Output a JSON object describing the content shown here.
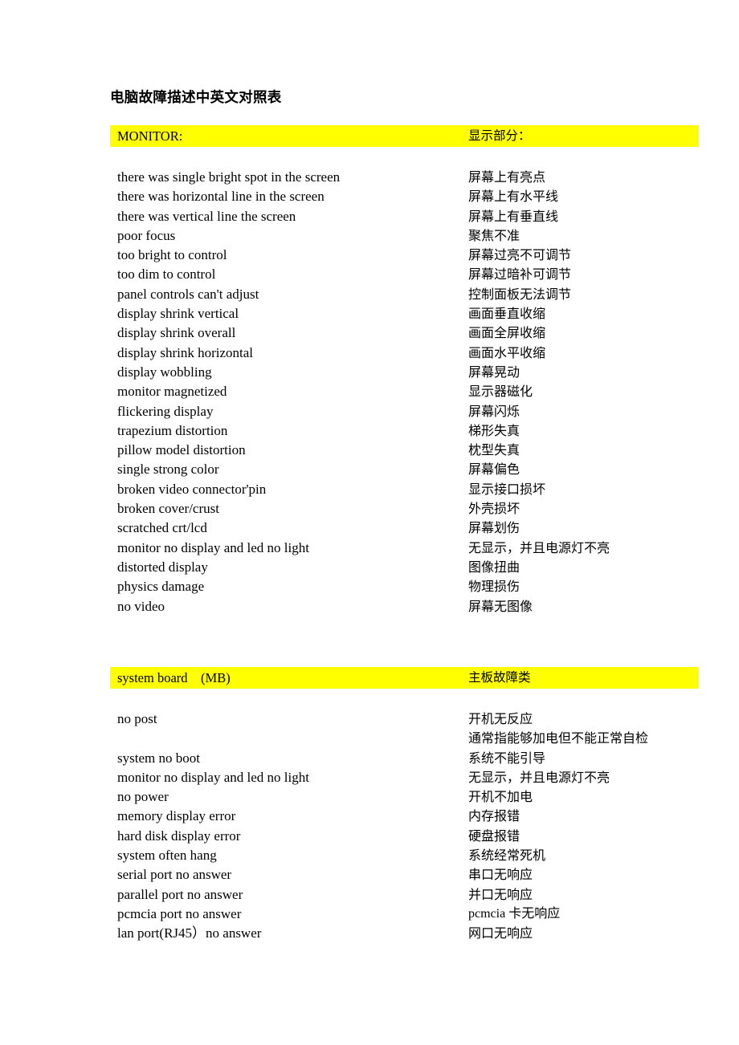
{
  "document": {
    "title": "电脑故障描述中英文对照表"
  },
  "colors": {
    "highlight": "#ffff00",
    "text": "#000000",
    "page_background": "#ffffff"
  },
  "sections": [
    {
      "id": "monitor",
      "header_en": "MONITOR:",
      "header_zh": "显示部分：",
      "rows": [
        {
          "en": "there was single bright spot in the screen",
          "zh": "屏幕上有亮点"
        },
        {
          "en": "there was horizontal line in the screen",
          "zh": "屏幕上有水平线"
        },
        {
          "en": "there was vertical line the screen",
          "zh": "屏幕上有垂直线"
        },
        {
          "en": "poor focus",
          "zh": "聚焦不准"
        },
        {
          "en": "too bright to control",
          "zh": "屏幕过亮不可调节"
        },
        {
          "en": "too dim to control",
          "zh": "屏幕过暗补可调节"
        },
        {
          "en": "panel controls can't adjust",
          "zh": "控制面板无法调节"
        },
        {
          "en": "display shrink vertical",
          "zh": "画面垂直收缩"
        },
        {
          "en": "display shrink overall",
          "zh": "画面全屏收缩"
        },
        {
          "en": "display shrink horizontal",
          "zh": "画面水平收缩"
        },
        {
          "en": "display wobbling",
          "zh": "屏幕晃动"
        },
        {
          "en": "monitor magnetized",
          "zh": "显示器磁化"
        },
        {
          "en": "flickering display",
          "zh": "屏幕闪烁"
        },
        {
          "en": "trapezium distortion",
          "zh": "梯形失真"
        },
        {
          "en": "pillow model distortion",
          "zh": "枕型失真"
        },
        {
          "en": "single strong color",
          "zh": "屏幕偏色"
        },
        {
          "en": "broken video connector'pin",
          "zh": "显示接口损坏"
        },
        {
          "en": "broken cover/crust",
          "zh": "外壳损坏"
        },
        {
          "en": "scratched crt/lcd",
          "zh": "屏幕划伤"
        },
        {
          "en": "monitor no display and led no light",
          "zh": "无显示，并且电源灯不亮"
        },
        {
          "en": "distorted display",
          "zh": "图像扭曲"
        },
        {
          "en": "physics damage",
          "zh": "物理损伤"
        },
        {
          "en": "no video",
          "zh": "屏幕无图像"
        }
      ]
    },
    {
      "id": "mainboard",
      "header_en": "system board    (MB)",
      "header_zh": "主板故障类",
      "rows": [
        {
          "en": "no post",
          "zh": "开机无反应"
        },
        {
          "en": "",
          "zh": "通常指能够加电但不能正常自检"
        },
        {
          "en": "system no boot",
          "zh": "系统不能引导"
        },
        {
          "en": "monitor no display and led no light",
          "zh": "无显示，并且电源灯不亮"
        },
        {
          "en": "no power",
          "zh": "开机不加电"
        },
        {
          "en": "memory display error",
          "zh": "内存报错"
        },
        {
          "en": "hard disk display error",
          "zh": "硬盘报错"
        },
        {
          "en": "system often hang",
          "zh": "系统经常死机"
        },
        {
          "en": "serial port no answer",
          "zh": "串口无响应"
        },
        {
          "en": "parallel port no answer",
          "zh": "并口无响应"
        },
        {
          "en": "pcmcia port no answer",
          "zh": "pcmcia 卡无响应",
          "zh_mixed": true
        },
        {
          "en": "lan port(RJ45）no answer",
          "zh": "网口无响应"
        }
      ]
    }
  ]
}
